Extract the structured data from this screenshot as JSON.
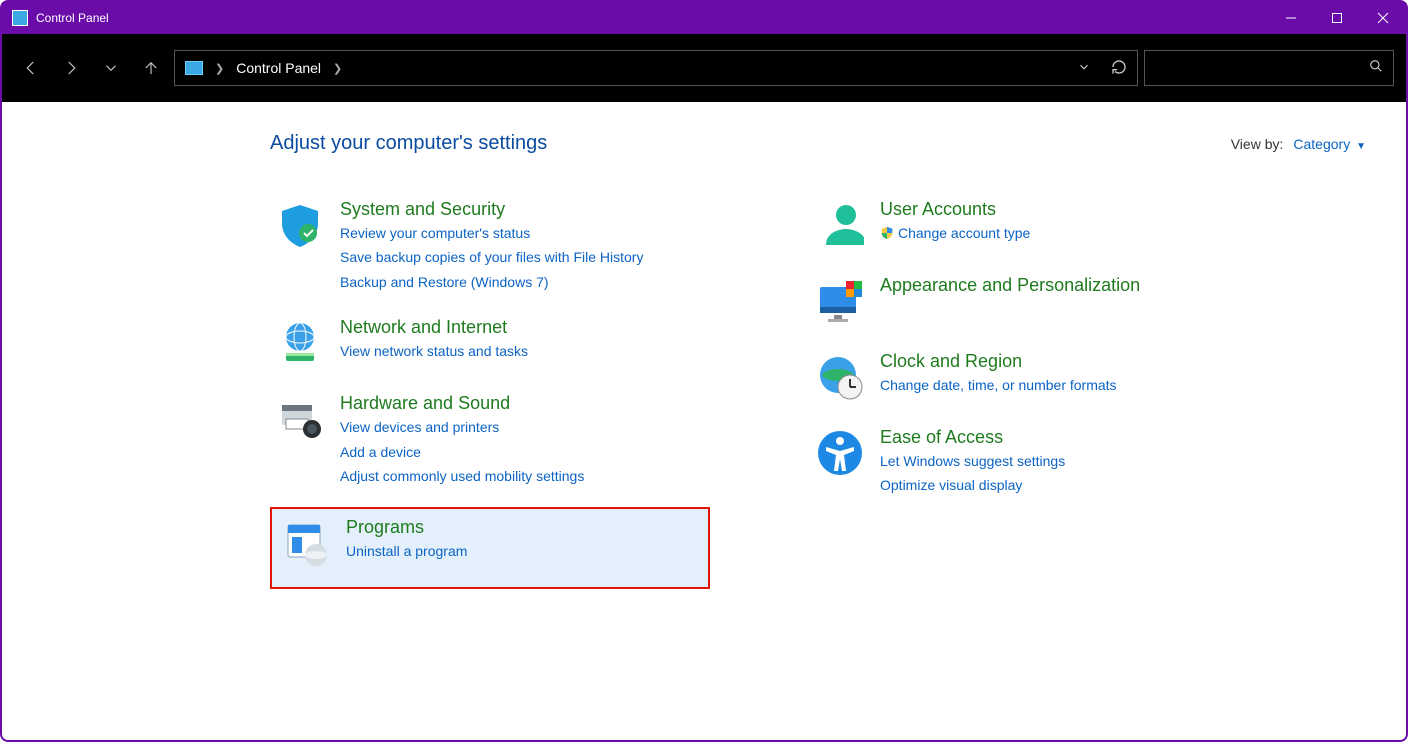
{
  "window": {
    "title": "Control Panel"
  },
  "address": {
    "location": "Control Panel"
  },
  "search": {
    "placeholder": ""
  },
  "header": {
    "heading": "Adjust your computer's settings",
    "viewby_label": "View by:",
    "viewby_value": "Category"
  },
  "left": [
    {
      "title": "System and Security",
      "links": [
        "Review your computer's status",
        "Save backup copies of your files with File History",
        "Backup and Restore (Windows 7)"
      ]
    },
    {
      "title": "Network and Internet",
      "links": [
        "View network status and tasks"
      ]
    },
    {
      "title": "Hardware and Sound",
      "links": [
        "View devices and printers",
        "Add a device",
        "Adjust commonly used mobility settings"
      ]
    },
    {
      "title": "Programs",
      "links": [
        "Uninstall a program"
      ],
      "highlighted": true
    }
  ],
  "right": [
    {
      "title": "User Accounts",
      "links": [
        "Change account type"
      ],
      "shield_on_first": true
    },
    {
      "title": "Appearance and Personalization",
      "links": []
    },
    {
      "title": "Clock and Region",
      "links": [
        "Change date, time, or number formats"
      ]
    },
    {
      "title": "Ease of Access",
      "links": [
        "Let Windows suggest settings",
        "Optimize visual display"
      ]
    }
  ]
}
